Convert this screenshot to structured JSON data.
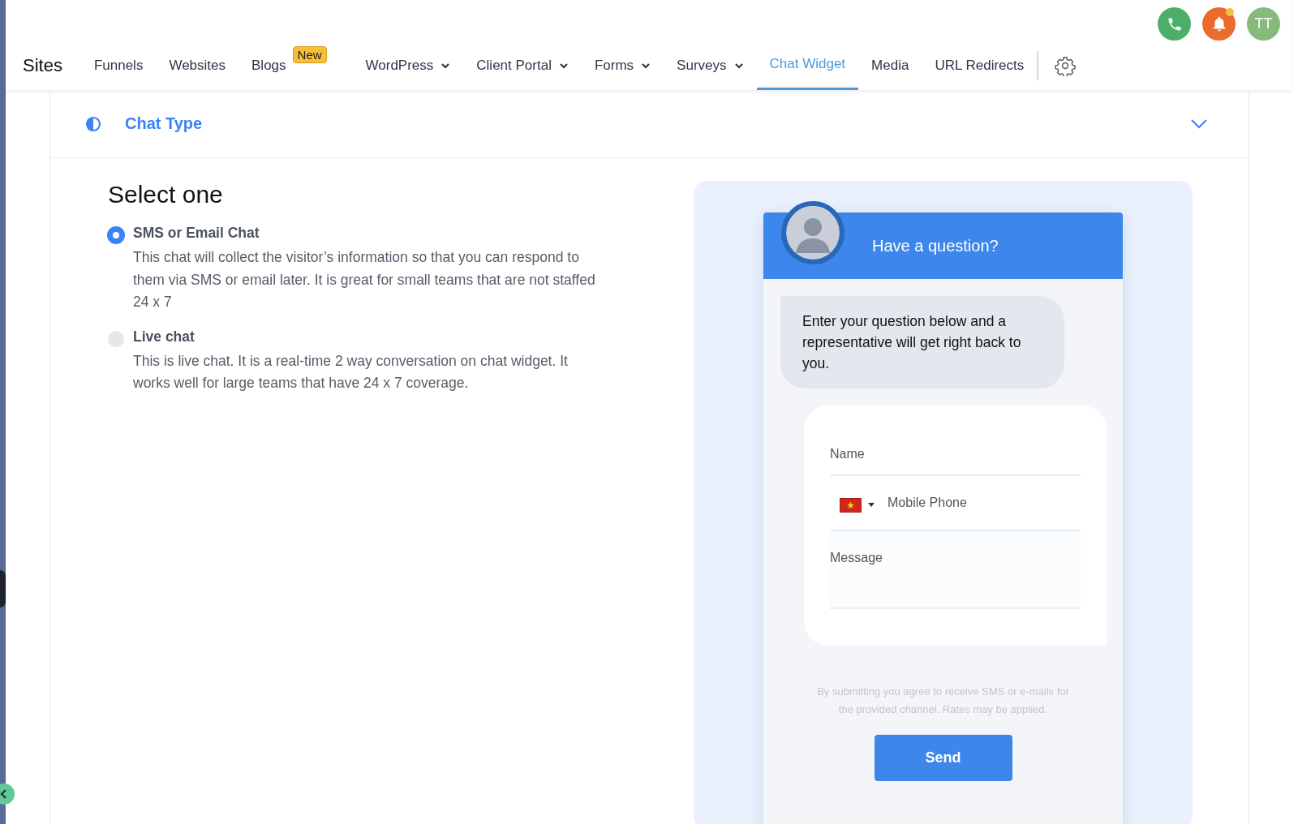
{
  "header_actions": {
    "avatar_initials": "TT",
    "notification_unread": true
  },
  "nav": {
    "title": "Sites",
    "items": [
      {
        "label": "Funnels",
        "selected": false,
        "dropdown": false
      },
      {
        "label": "Websites",
        "selected": false,
        "dropdown": false
      },
      {
        "label": "Blogs",
        "selected": false,
        "dropdown": false,
        "badge": "New"
      },
      {
        "label": "WordPress",
        "selected": false,
        "dropdown": true
      },
      {
        "label": "Client Portal",
        "selected": false,
        "dropdown": true
      },
      {
        "label": "Forms",
        "selected": false,
        "dropdown": true
      },
      {
        "label": "Surveys",
        "selected": false,
        "dropdown": true
      },
      {
        "label": "Chat Widget",
        "selected": true,
        "dropdown": false
      },
      {
        "label": "Media",
        "selected": false,
        "dropdown": false
      },
      {
        "label": "URL Redirects",
        "selected": false,
        "dropdown": false
      }
    ]
  },
  "section": {
    "title": "Chat Type",
    "expanded": true
  },
  "select": {
    "heading": "Select one",
    "options": [
      {
        "label": "SMS or Email Chat",
        "description": "This chat will collect the visitor’s information so that you can respond to them via SMS or email later. It is great for small teams that are not staffed 24 x 7",
        "selected": true
      },
      {
        "label": "Live chat",
        "description": "This is live chat. It is a real-time 2 way conversation on chat widget. It works well for large teams that have 24 x 7 coverage.",
        "selected": false
      }
    ]
  },
  "preview": {
    "header_title": "Have a question?",
    "greeting": "Enter your question below and a representative will get right back to you.",
    "fields": [
      {
        "kind": "text",
        "placeholder": "Name"
      },
      {
        "kind": "phone",
        "placeholder": "Mobile Phone"
      },
      {
        "kind": "textarea",
        "placeholder": "Message"
      }
    ],
    "consent": "By submitting you agree to receive SMS or e-mails for the provided channel. Rates may be applied.",
    "button": "Send"
  }
}
